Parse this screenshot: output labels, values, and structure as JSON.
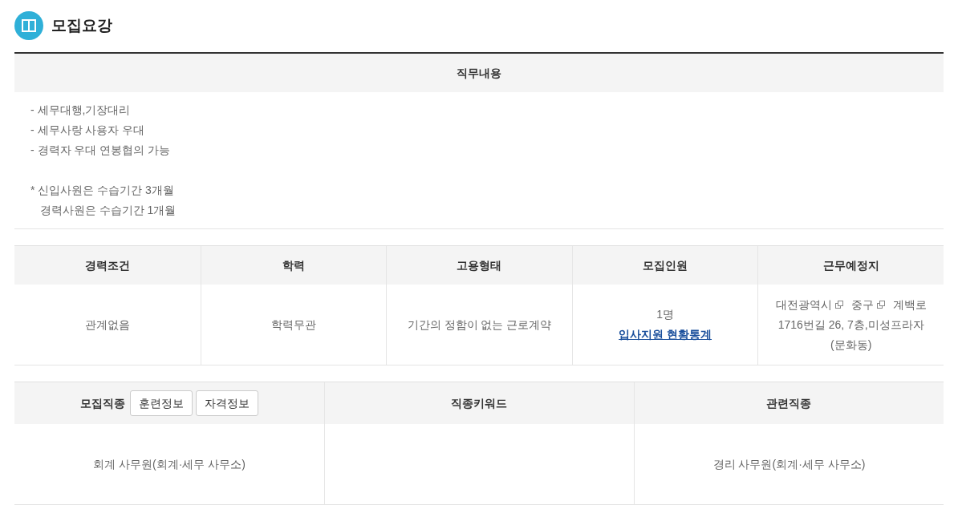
{
  "section_title": "모집요강",
  "job_description": {
    "heading": "직무내용",
    "lines": [
      "- 세무대행,기장대리",
      "- 세무사랑 사용자 우대",
      "- 경력자 우대 연봉협의 가능"
    ],
    "notes": [
      "* 신입사원은 수습기간 3개월",
      "   경력사원은 수습기간 1개월"
    ]
  },
  "conditions": {
    "columns": [
      "경력조건",
      "학력",
      "고용형태",
      "모집인원",
      "근무예정지"
    ],
    "cells": [
      {
        "parts": [
          {
            "kind": "plain",
            "text": "관계없음"
          }
        ]
      },
      {
        "parts": [
          {
            "kind": "plain",
            "text": "학력무관"
          }
        ]
      },
      {
        "parts": [
          {
            "kind": "plain",
            "text": "기간의 정함이 없는 근로계약"
          }
        ]
      },
      {
        "parts": [
          {
            "kind": "plain",
            "text": "1명"
          },
          {
            "kind": "link",
            "text": "입사지원 현황통계"
          }
        ]
      },
      {
        "parts": [
          {
            "kind": "region",
            "text": "대전광역시"
          },
          {
            "kind": "region",
            "text": "중구"
          },
          {
            "kind": "plain",
            "text": "계백로"
          },
          {
            "kind": "line",
            "text": "1716번길 26, 7층,미성프라자"
          },
          {
            "kind": "line",
            "text": "(문화동)"
          }
        ]
      }
    ]
  },
  "occupation": {
    "columns": [
      {
        "label": "모집직종",
        "buttons": [
          "훈련정보",
          "자격정보"
        ]
      },
      {
        "label": "직종키워드"
      },
      {
        "label": "관련직종"
      }
    ],
    "cells": [
      "회계 사무원(회계·세무 사무소)",
      "",
      "경리 사무원(회계·세무 사무소)"
    ]
  }
}
